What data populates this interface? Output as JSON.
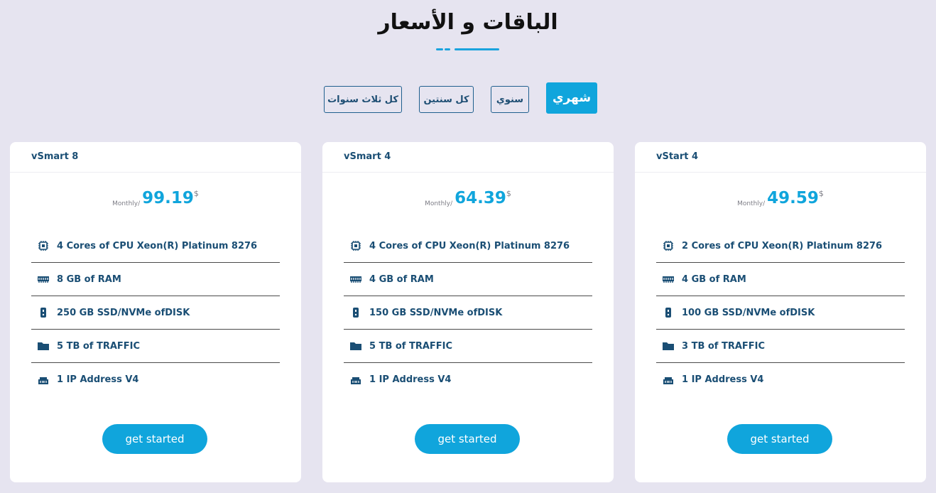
{
  "section": {
    "title": "الباقات و الأسعار"
  },
  "billing_tabs": [
    {
      "label": "شهري",
      "active": true
    },
    {
      "label": "سنوي",
      "active": false
    },
    {
      "label": "كل سنتين",
      "active": false
    },
    {
      "label": "كل ثلاث سنوات",
      "active": false
    }
  ],
  "plans": [
    {
      "name": "vSmart 8",
      "period": "Monthly/",
      "price": "99.19",
      "currency": "$",
      "features": [
        "4 Cores of CPU Xeon(R) Platinum 8276",
        "8 GB of RAM",
        "250 GB SSD/NVMe ofDISK",
        "5 TB of TRAFFIC",
        "1 IP Address V4"
      ],
      "cta": "get started"
    },
    {
      "name": "vSmart 4",
      "period": "Monthly/",
      "price": "64.39",
      "currency": "$",
      "features": [
        "4 Cores of CPU Xeon(R) Platinum 8276",
        "4 GB of RAM",
        "150 GB SSD/NVMe ofDISK",
        "5 TB of TRAFFIC",
        "1 IP Address V4"
      ],
      "cta": "get started"
    },
    {
      "name": "vStart 4",
      "period": "Monthly/",
      "price": "49.59",
      "currency": "$",
      "features": [
        "2 Cores of CPU Xeon(R) Platinum 8276",
        "4 GB of RAM",
        "100 GB SSD/NVMe ofDISK",
        "3 TB of TRAFFIC",
        "1 IP Address V4"
      ],
      "cta": "get started"
    }
  ],
  "feature_icons": [
    "cpu-icon",
    "memory-icon",
    "disk-icon",
    "folder-icon",
    "network-icon"
  ],
  "colors": {
    "accent": "#10a5dc",
    "text": "#1a4e74",
    "background": "#e6e4f0"
  }
}
